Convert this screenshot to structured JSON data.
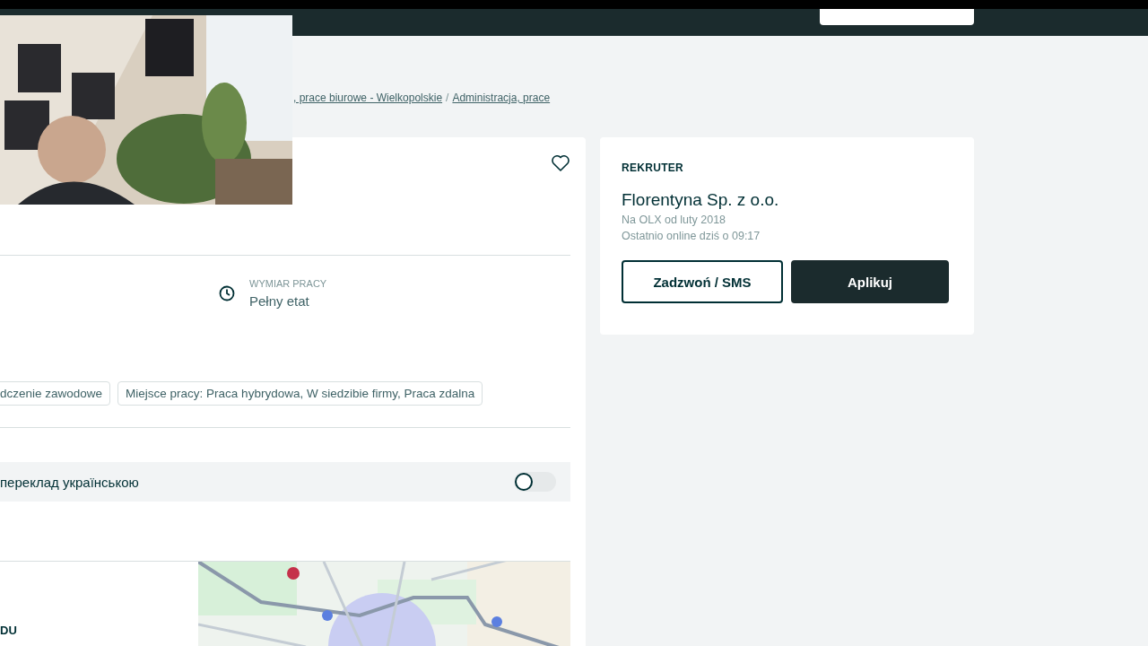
{
  "breadcrumb": {
    "items": [
      ", prace biurowe - Wielkopolskie",
      "Administracja, prace"
    ],
    "separator": "/"
  },
  "job": {
    "favorite": false,
    "details": [
      {
        "label": "WYMIAR PRACY",
        "value": "Pełny etat"
      }
    ],
    "tags": [
      "dczenie zawodowe",
      "Miejsce pracy: Praca hybrydowa, W siedzibie firmy, Praca zdalna"
    ],
    "translation": {
      "label": "переклад українською",
      "on": false
    },
    "section_heading": "DU"
  },
  "recruiter": {
    "heading": "REKRUTER",
    "name": "Florentyna Sp. z o.o.",
    "since": "Na OLX od luty 2018",
    "last_online": "Ostatnio online dziś o 09:17",
    "buttons": [
      {
        "label": "Zadzwoń / SMS",
        "kind": "secondary"
      },
      {
        "label": "Aplikuj",
        "kind": "primary"
      }
    ]
  }
}
